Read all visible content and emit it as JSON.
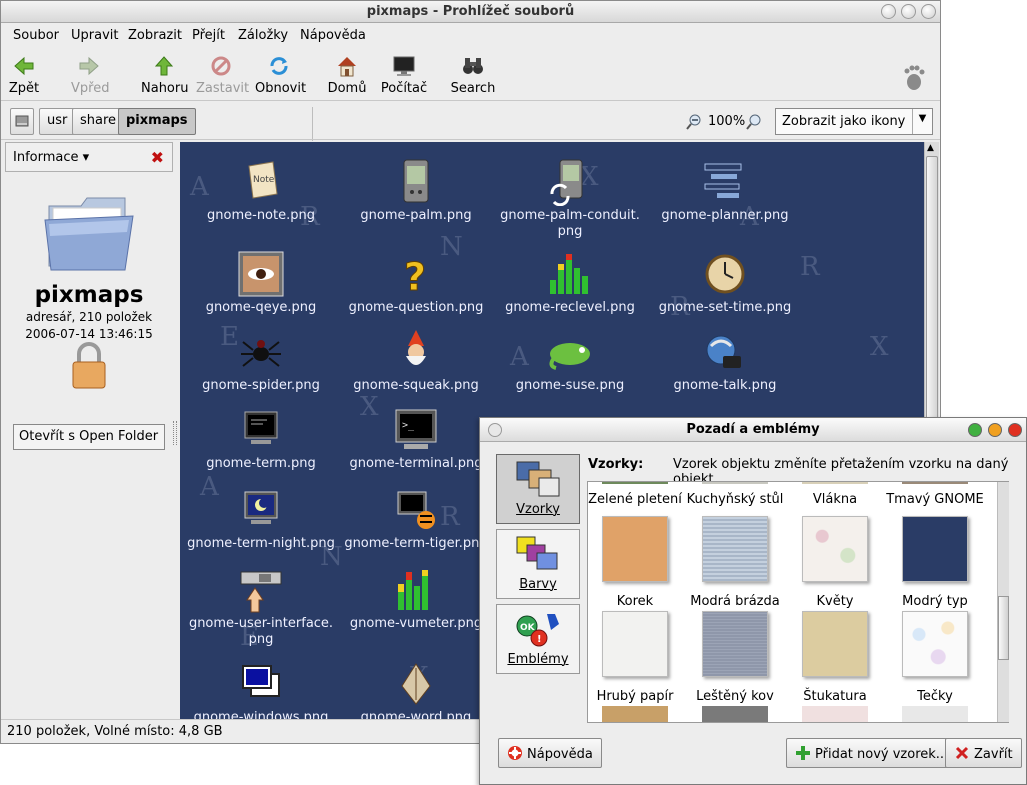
{
  "window": {
    "title": "pixmaps - Prohlížeč souborů"
  },
  "menubar": [
    "Soubor",
    "Upravit",
    "Zobrazit",
    "Přejít",
    "Záložky",
    "Nápověda"
  ],
  "toolbar": {
    "back": "Zpět",
    "forward": "Vpřed",
    "up": "Nahoru",
    "stop": "Zastavit",
    "reload": "Obnovit",
    "home": "Domů",
    "computer": "Počítač",
    "search": "Search"
  },
  "location": {
    "path": [
      "usr",
      "share",
      "pixmaps"
    ],
    "zoom": "100%",
    "view_mode": "Zobrazit jako ikony"
  },
  "sidebar": {
    "header": "Informace",
    "folder_name": "pixmaps",
    "folder_info": "adresář, 210 položek",
    "folder_date": "2006-07-14 13:46:15",
    "open_with": "Otevřít s Open Folder"
  },
  "files": [
    "gnome-note.png",
    "gnome-palm.png",
    "gnome-palm-conduit.\npng",
    "gnome-planner.png",
    "gnome-qeye.png",
    "gnome-question.png",
    "gnome-reclevel.png",
    "gnome-set-time.png",
    "gnome-spider.png",
    "gnome-squeak.png",
    "gnome-suse.png",
    "gnome-talk.png",
    "gnome-term.png",
    "gnome-terminal.png",
    "gnome-term-night.png",
    "gnome-term-tiger.png",
    "gnome-user-interface.\npng",
    "gnome-vumeter.png",
    "gnome-windows.png",
    "gnome-word.png"
  ],
  "status": "210 položek, Volné místo: 4,8 GB",
  "dialog": {
    "title": "Pozadí a emblémy",
    "categories": [
      "Vzorky",
      "Barvy",
      "Emblémy"
    ],
    "heading": "Vzorky:",
    "hint": "Vzorek objektu změníte přetažením vzorku na daný objekt",
    "top_labels": [
      "Zelené pletení",
      "Kuchyňský stůl",
      "Vlákna",
      "Tmavý GNOME"
    ],
    "swatches": [
      {
        "label": "Korek",
        "color": "#e0a268"
      },
      {
        "label": "Modrá brázda",
        "color": "#a8b6c8"
      },
      {
        "label": "Květy",
        "color": "#efe8e6"
      },
      {
        "label": "Modrý typ",
        "color": "#2a3c66"
      },
      {
        "label": "Hrubý papír",
        "color": "#f2f2f0"
      },
      {
        "label": "Leštěný kov",
        "color": "#8f97aa"
      },
      {
        "label": "Štukatura",
        "color": "#dccca0"
      },
      {
        "label": "Tečky",
        "color": "#fafafa"
      }
    ],
    "buttons": {
      "help": "Nápověda",
      "add": "Přidat nový vzorek...",
      "close": "Zavřít"
    }
  },
  "colors": {
    "content_bg": "#2a3c66",
    "dialog_close": "#e03020",
    "dialog_min": "#f0a020",
    "dialog_max": "#40b040"
  }
}
